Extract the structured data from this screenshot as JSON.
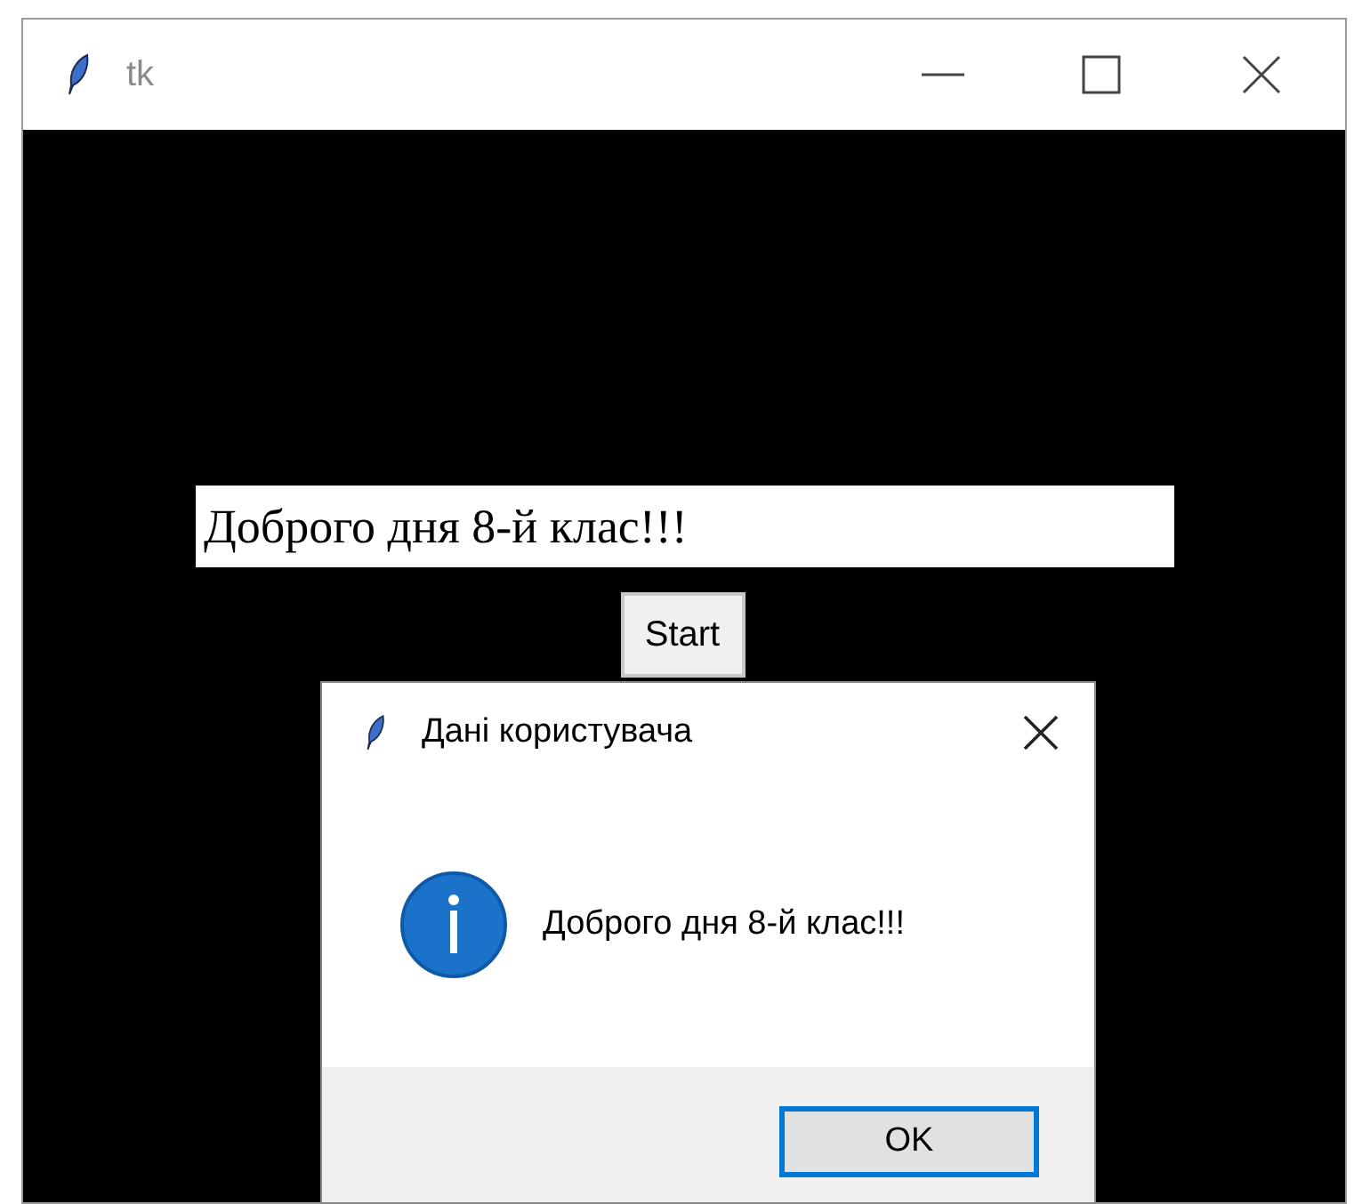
{
  "window": {
    "title": "tk"
  },
  "entry": {
    "value": "Доброго дня 8-й клас!!!"
  },
  "start_button": {
    "label": "Start"
  },
  "dialog": {
    "title": "Дані користувача",
    "message": "Доброго дня 8-й клас!!!",
    "ok_button": {
      "label": "OK",
      "focused": true
    }
  }
}
